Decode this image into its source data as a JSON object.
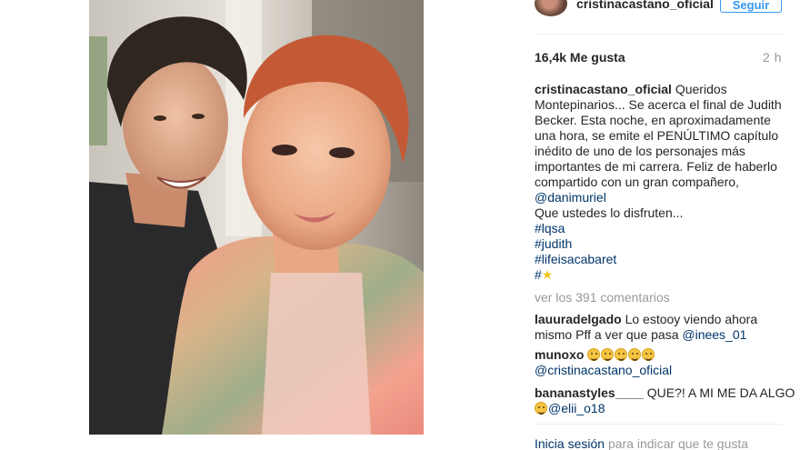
{
  "post": {
    "author": "cristinacastano_oficial",
    "follow_label": "Seguir",
    "likes": "16,4k Me gusta",
    "time": "2 h"
  },
  "caption": {
    "user": "cristinacastano_oficial",
    "line1": "Queridos",
    "line2": "Montepinarios... Se acerca el final de Judith",
    "line3": "Becker. Esta noche, en aproximadamente",
    "line4": "una hora, se emite el PENÚLTIMO capítulo",
    "line5": "inédito de uno de los personajes más",
    "line6": "importantes de mi carrera. Feliz de haberlo",
    "line7": "compartido con un gran compañero,",
    "mention": "@danimuriel",
    "line9": "Que ustedes lo disfruten...",
    "hashtags": [
      "#lqsa",
      "#judith",
      "#lifeisacabaret",
      "#"
    ],
    "star_icon": "star-emoji-icon"
  },
  "more_comments": "ver los 391 comentarios",
  "comments": [
    {
      "user": "lauuradelgado",
      "text1": "Lo estooy viendo ahora",
      "text2": "mismo Pff a ver que pasa",
      "mention": "@inees_01"
    },
    {
      "user": "munoxo",
      "emoji_count": 5,
      "mention": "@cristinacastano_oficial"
    },
    {
      "user": "bananastyles____",
      "text1": "QUE?! A MI ME DA ALGO",
      "mention": "@elii_o18"
    }
  ],
  "footer": {
    "login": "Inicia sesión",
    "text": "para indicar que te gusta"
  },
  "colors": {
    "link": "#003569",
    "follow": "#3897f0",
    "muted": "#999999"
  }
}
